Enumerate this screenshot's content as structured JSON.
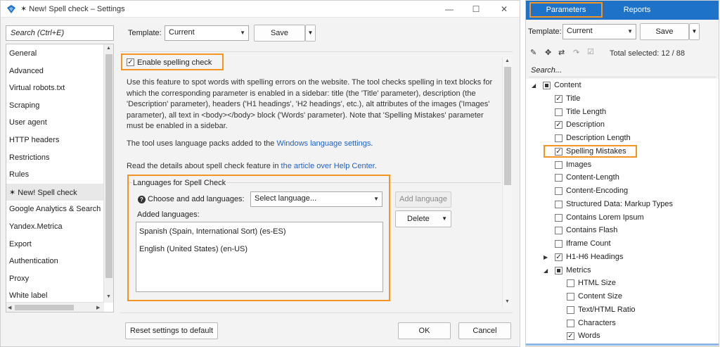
{
  "window": {
    "title": "✶ New! Spell check – Settings",
    "minimize": "—",
    "maximize": "☐",
    "close": "✕"
  },
  "template": {
    "label": "Template:",
    "value": "Current",
    "save_label": "Save"
  },
  "search": {
    "placeholder": "Search (Ctrl+E)"
  },
  "nav_items": [
    "General",
    "Advanced",
    "Virtual robots.txt",
    "Scraping",
    "User agent",
    "HTTP headers",
    "Restrictions",
    "Rules",
    "✶ New! Spell check",
    "Google Analytics & Search",
    "Yandex.Metrica",
    "Export",
    "Authentication",
    "Proxy",
    "White label"
  ],
  "selected_nav_index": 8,
  "spell": {
    "enable_label": "Enable spelling check",
    "enabled": true,
    "description": "Use this feature to spot words with spelling errors on the website. The tool checks spelling in text blocks for which the corresponding parameter is enabled in a sidebar: title (the 'Title' parameter), description (the 'Description' parameter), headers ('H1 headings', 'H2 headings', etc.), alt attributes of the images ('Images' parameter), all text in <body></body> block ('Words' parameter). Note that 'Spelling Mistakes' parameter must be enabled in a sidebar.",
    "p2_prefix": "The tool uses language packs added to the ",
    "p2_link": "Windows language settings",
    "p2_suffix": ".",
    "p3_prefix": "Read the details about spell check feature in ",
    "p3_link": "the article over Help Center",
    "p3_suffix": "."
  },
  "languages": {
    "group_title": "Languages for Spell Check",
    "choose_label": "Choose and add languages:",
    "select_placeholder": "Select language...",
    "add_button": "Add language",
    "delete_button": "Delete",
    "added_label": "Added languages:",
    "added": [
      "Spanish (Spain, International Sort) (es-ES)",
      "English (United States) (en-US)"
    ]
  },
  "footer": {
    "reset": "Reset settings to default",
    "ok": "OK",
    "cancel": "Cancel"
  },
  "panel": {
    "tabs": [
      "Parameters",
      "Reports"
    ],
    "active_tab": 0,
    "template_label": "Template:",
    "template_value": "Current",
    "save_label": "Save",
    "total_selected": "Total selected: 12 / 88",
    "search_placeholder": "Search...",
    "tree": [
      {
        "label": "Content",
        "level": 0,
        "state": "partial",
        "expander": "expanded"
      },
      {
        "label": "Title",
        "level": 1,
        "state": "checked"
      },
      {
        "label": "Title Length",
        "level": 1,
        "state": "unchecked"
      },
      {
        "label": "Description",
        "level": 1,
        "state": "checked"
      },
      {
        "label": "Description Length",
        "level": 1,
        "state": "unchecked"
      },
      {
        "label": "Spelling Mistakes",
        "level": 1,
        "state": "checked"
      },
      {
        "label": "Images",
        "level": 1,
        "state": "unchecked"
      },
      {
        "label": "Content-Length",
        "level": 1,
        "state": "unchecked"
      },
      {
        "label": "Content-Encoding",
        "level": 1,
        "state": "unchecked"
      },
      {
        "label": "Structured Data: Markup Types",
        "level": 1,
        "state": "unchecked"
      },
      {
        "label": "Contains Lorem Ipsum",
        "level": 1,
        "state": "unchecked"
      },
      {
        "label": "Contains Flash",
        "level": 1,
        "state": "unchecked"
      },
      {
        "label": "Iframe Count",
        "level": 1,
        "state": "unchecked"
      },
      {
        "label": "H1-H6 Headings",
        "level": 1,
        "state": "checked",
        "expander": "collapsed"
      },
      {
        "label": "Metrics",
        "level": 1,
        "state": "partial",
        "expander": "expanded"
      },
      {
        "label": "HTML Size",
        "level": 2,
        "state": "unchecked"
      },
      {
        "label": "Content Size",
        "level": 2,
        "state": "unchecked"
      },
      {
        "label": "Text/HTML Ratio",
        "level": 2,
        "state": "unchecked"
      },
      {
        "label": "Characters",
        "level": 2,
        "state": "unchecked"
      },
      {
        "label": "Words",
        "level": 2,
        "state": "checked"
      }
    ]
  },
  "colors": {
    "accent": "#1e72c8",
    "highlight": "#f39423",
    "link": "#1f62c6"
  }
}
